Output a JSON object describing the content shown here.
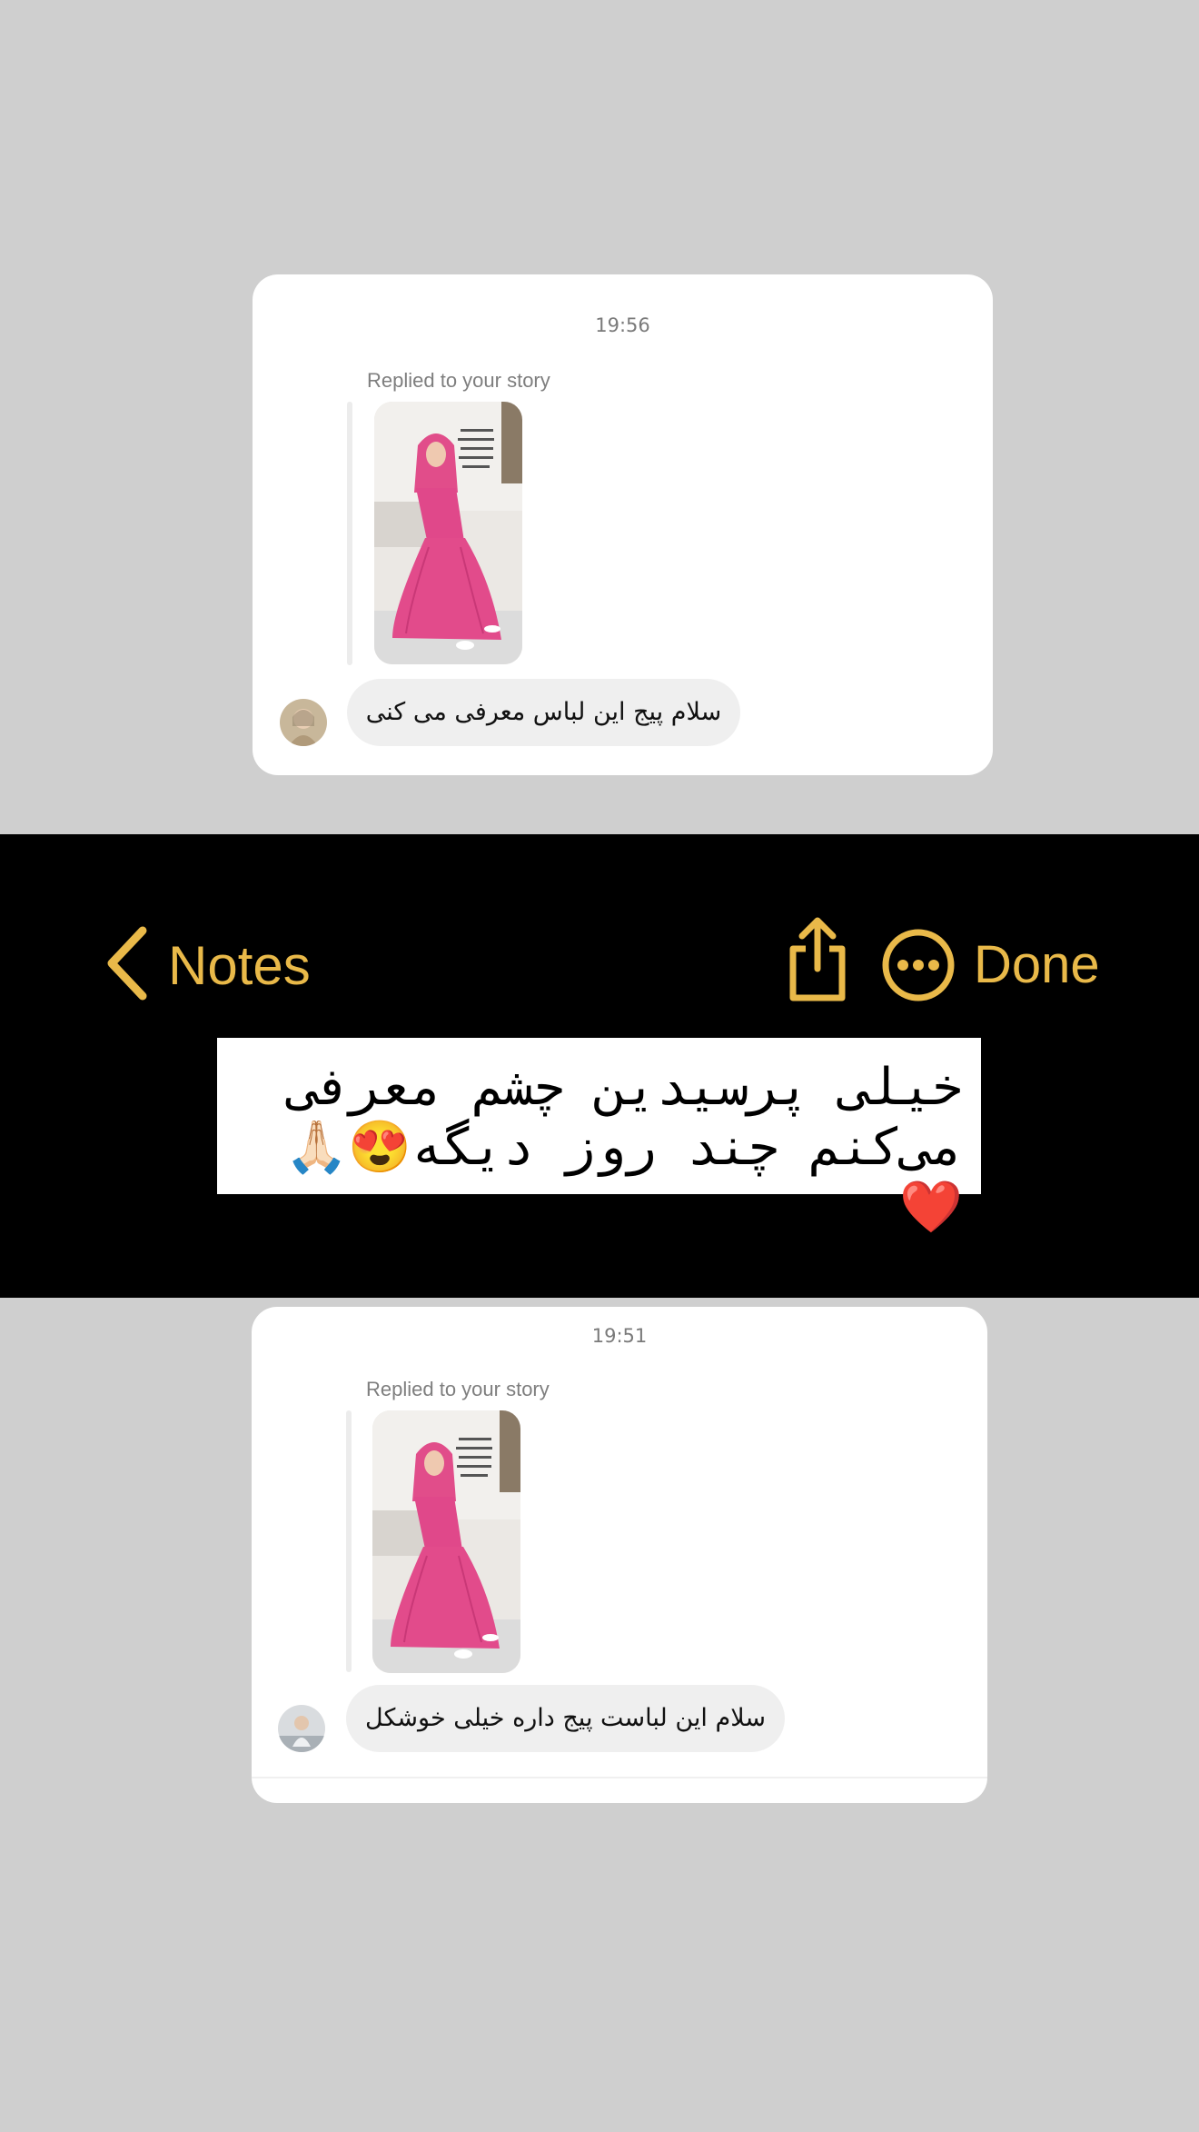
{
  "message_top": {
    "timestamp": "19:56",
    "reply_label": "Replied to your story",
    "message_text": "سلام پیج این لباس معرفی می کنی"
  },
  "notes_bar": {
    "back_label": "Notes",
    "done_label": "Done",
    "accent_color": "#e9b949",
    "icons": [
      "chevron-left-icon",
      "share-icon",
      "more-icon"
    ]
  },
  "note": {
    "text": "خیلی پرسیدین چشم معرفی می‌کنم چند روز دیگه😍🙏🏻❤️"
  },
  "message_bottom": {
    "timestamp": "19:51",
    "reply_label": "Replied to your story",
    "message_text": "سلام این لباست پیج داره خیلی خوشکل"
  }
}
